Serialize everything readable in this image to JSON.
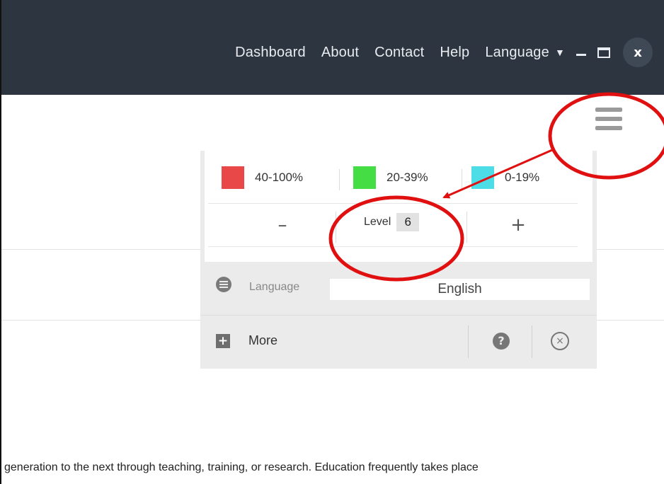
{
  "nav": {
    "links": [
      "Dashboard",
      "About",
      "Contact",
      "Help"
    ],
    "language_label": "Language",
    "close_symbol": "x"
  },
  "panel": {
    "legend": [
      {
        "label": "40-100%",
        "color": "#e84848"
      },
      {
        "label": "20-39%",
        "color": "#44dd44"
      },
      {
        "label": "0-19%",
        "color": "#4ddde6"
      }
    ],
    "level": {
      "label": "Level",
      "value": "6",
      "decrease_symbol": "–",
      "increase_symbol": "+"
    },
    "language": {
      "label": "Language",
      "value": "English"
    },
    "more_label": "More",
    "help_symbol": "?",
    "close_symbol": "×"
  },
  "content": {
    "text": "generation to the next through teaching, training, or research. Education frequently takes place"
  },
  "colors": {
    "topbar": "#2c3540",
    "annotation": "#e01010"
  },
  "icons": [
    "chevron-down-icon",
    "minimize-icon",
    "maximize-icon",
    "close-icon",
    "hamburger-menu-icon",
    "list-icon",
    "plus-square-icon",
    "help-circle-icon",
    "close-circle-icon"
  ]
}
